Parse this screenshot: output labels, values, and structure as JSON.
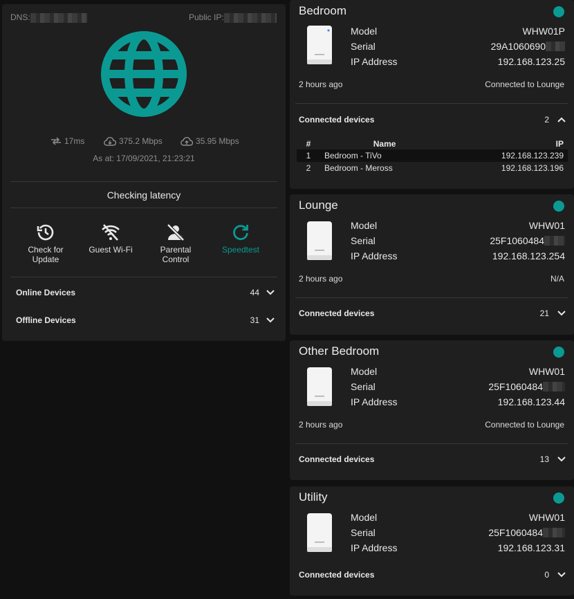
{
  "header": {
    "dns_label": "DNS:",
    "public_ip_label": "Public IP:"
  },
  "speed": {
    "latency": "17ms",
    "download": "375.2 Mbps",
    "upload": "35.95 Mbps",
    "as_at": "As at: 17/09/2021, 21:23:21"
  },
  "status_text": "Checking latency",
  "actions": [
    {
      "label": "Check for Update",
      "icon": "clock-update-icon"
    },
    {
      "label": "Guest Wi-Fi",
      "icon": "wifi-off-icon"
    },
    {
      "label": "Parental Control",
      "icon": "person-off-icon"
    },
    {
      "label": "Speedtest",
      "icon": "refresh-icon"
    }
  ],
  "device_summary": [
    {
      "label": "Online Devices",
      "count": "44"
    },
    {
      "label": "Offline Devices",
      "count": "31"
    }
  ],
  "colors": {
    "accent": "#0b9a93",
    "card": "#1f1f1f",
    "background": "#111111"
  },
  "labels": {
    "model": "Model",
    "serial": "Serial",
    "ip": "IP Address",
    "connected_devices": "Connected devices",
    "col_num": "#",
    "col_name": "Name",
    "col_ip": "IP"
  },
  "nodes": [
    {
      "name": "Bedroom",
      "model": "WHW01P",
      "serial": "29A1060690",
      "ip": "192.168.123.25",
      "updated": "2 hours ago",
      "connection": "Connected to Lounge",
      "connected_count": "2",
      "expanded": true,
      "devices": [
        {
          "num": "1",
          "name": "Bedroom - TiVo",
          "ip": "192.168.123.239"
        },
        {
          "num": "2",
          "name": "Bedroom - Meross",
          "ip": "192.168.123.196"
        }
      ]
    },
    {
      "name": "Lounge",
      "model": "WHW01",
      "serial": "25F1060484",
      "ip": "192.168.123.254",
      "updated": "2 hours ago",
      "connection": "N/A",
      "connected_count": "21",
      "expanded": false
    },
    {
      "name": "Other Bedroom",
      "model": "WHW01",
      "serial": "25F1060484",
      "ip": "192.168.123.44",
      "updated": "2 hours ago",
      "connection": "Connected to Lounge",
      "connected_count": "13",
      "expanded": false
    },
    {
      "name": "Utility",
      "model": "WHW01",
      "serial": "25F1060484",
      "ip": "192.168.123.31",
      "connected_count": "0",
      "expanded": false
    }
  ]
}
